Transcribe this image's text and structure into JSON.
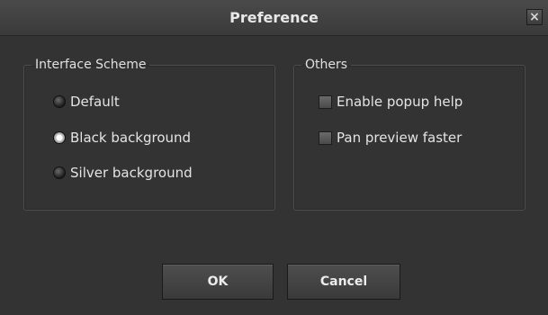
{
  "window": {
    "title": "Preference",
    "close_glyph": "×"
  },
  "interface_scheme": {
    "legend": "Interface Scheme",
    "options": [
      {
        "label": "Default",
        "selected": false
      },
      {
        "label": "Black background",
        "selected": true
      },
      {
        "label": "Silver background",
        "selected": false
      }
    ]
  },
  "others": {
    "legend": "Others",
    "options": [
      {
        "label": "Enable popup help",
        "checked": false
      },
      {
        "label": "Pan preview faster",
        "checked": false
      }
    ]
  },
  "buttons": {
    "ok": "OK",
    "cancel": "Cancel"
  }
}
